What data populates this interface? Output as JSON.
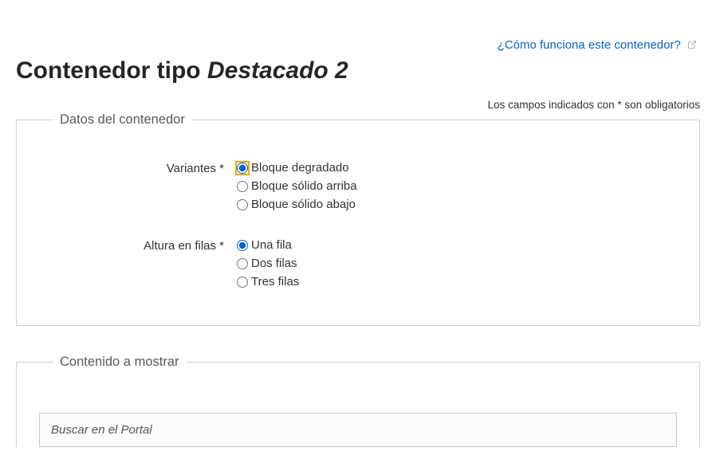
{
  "helpLink": {
    "text": "¿Cómo funciona este contenedor?"
  },
  "pageTitle": {
    "pre": "Contenedor tipo ",
    "emph": "Destacado 2"
  },
  "requiredNote": "Los campos indicados con * son obligatorios",
  "fieldset1": {
    "legend": "Datos del contenedor",
    "variantes": {
      "label": "Variantes *",
      "options": {
        "opt0": "Bloque degradado",
        "opt1": "Bloque sólido arriba",
        "opt2": "Bloque sólido abajo"
      }
    },
    "altura": {
      "label": "Altura en filas *",
      "options": {
        "opt0": "Una fila",
        "opt1": "Dos filas",
        "opt2": "Tres filas"
      }
    }
  },
  "fieldset2": {
    "legend": "Contenido a mostrar",
    "search": {
      "placeholder": "Buscar en el Portal"
    }
  }
}
